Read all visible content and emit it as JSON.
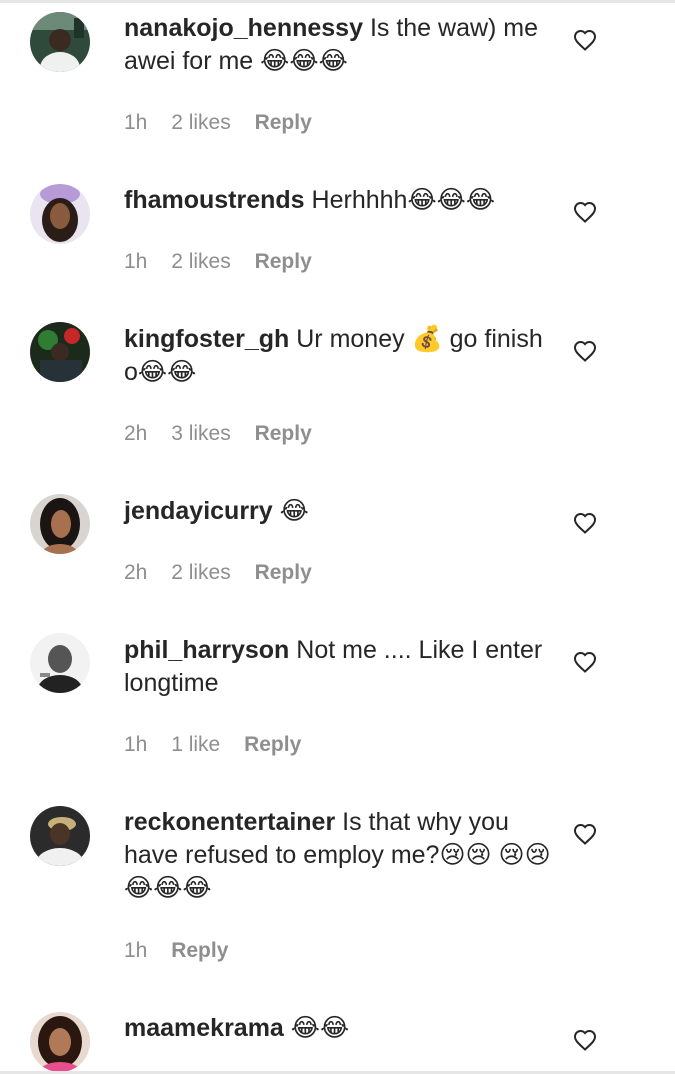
{
  "comments": [
    {
      "username": "nanakojo_hennessy",
      "text": "Is the waw) me awei for me 😂😂😂",
      "time": "1h",
      "likes": "2 likes",
      "reply": "Reply"
    },
    {
      "username": "fhamoustrends",
      "text": "Herhhhh😂😂😂",
      "time": "1h",
      "likes": "2 likes",
      "reply": "Reply"
    },
    {
      "username": "kingfoster_gh",
      "text": "Ur money 💰 go finish o😂😂",
      "time": "2h",
      "likes": "3 likes",
      "reply": "Reply"
    },
    {
      "username": "jendayicurry",
      "text": "😂",
      "time": "2h",
      "likes": "2 likes",
      "reply": "Reply"
    },
    {
      "username": "phil_harryson",
      "text": "Not me .... Like I enter longtime",
      "time": "1h",
      "likes": "1 like",
      "reply": "Reply"
    },
    {
      "username": "reckonentertainer",
      "text": "Is that why you have refused to employ me?😢😢 😢😢😂😂😂",
      "time": "1h",
      "likes": "",
      "reply": "Reply"
    },
    {
      "username": "maamekrama",
      "text": "😂😂",
      "time": "",
      "likes": "",
      "reply": ""
    }
  ],
  "colors": {
    "text": "#262626",
    "meta": "#8e8e8e",
    "divider": "#e6e6e6"
  },
  "icons": {
    "like": "heart-outline-icon"
  }
}
